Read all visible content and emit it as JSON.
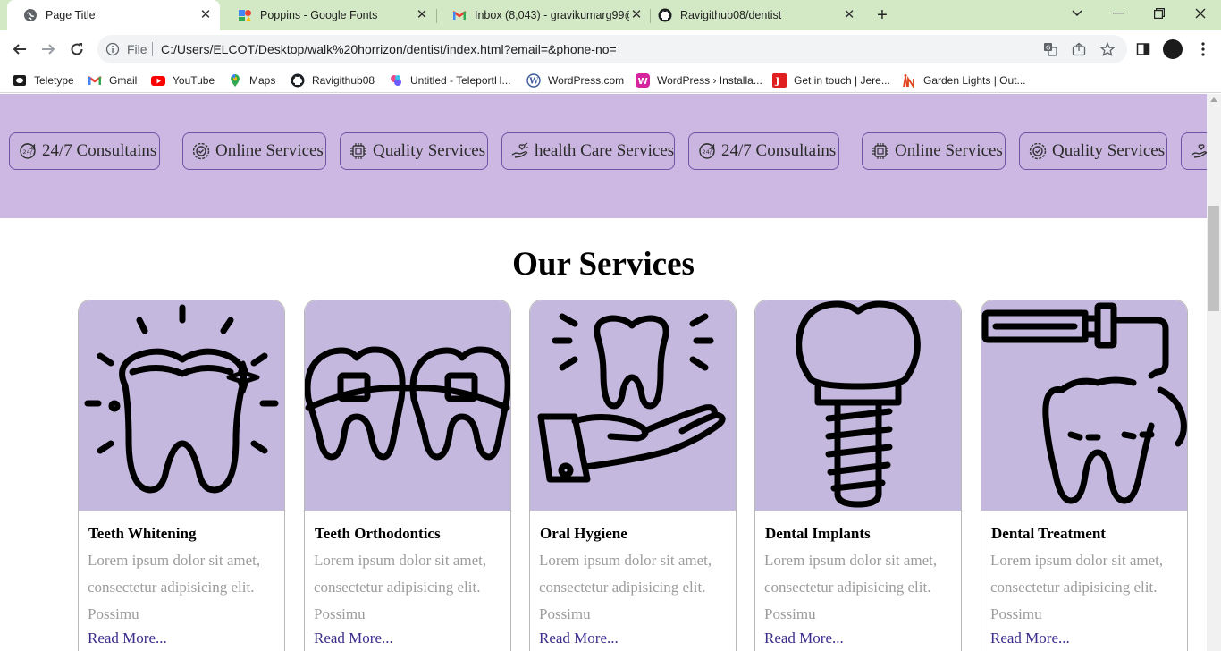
{
  "browser": {
    "tabs": [
      {
        "title": "Page Title",
        "icon": "globe-icon",
        "active": true
      },
      {
        "title": "Poppins - Google Fonts",
        "icon": "google-fonts-icon",
        "active": false
      },
      {
        "title": "Inbox (8,043) - gravikumarg99@g",
        "icon": "gmail-icon",
        "active": false
      },
      {
        "title": "Ravigithub08/dentist",
        "icon": "github-icon",
        "active": false
      }
    ],
    "new_tab": "+",
    "address": {
      "scheme_label": "File",
      "url": "C:/Users/ELCOT/Desktop/walk%20horrizon/dentist/index.html?email=&phone-no="
    },
    "bookmarks": [
      {
        "label": "Teletype",
        "icon": "teletype-icon"
      },
      {
        "label": "Gmail",
        "icon": "gmail-icon"
      },
      {
        "label": "YouTube",
        "icon": "youtube-icon"
      },
      {
        "label": "Maps",
        "icon": "maps-icon"
      },
      {
        "label": "Ravigithub08",
        "icon": "github-icon"
      },
      {
        "label": "Untitled - TeleportH...",
        "icon": "teleporthq-icon"
      },
      {
        "label": "WordPress.com",
        "icon": "wordpress-icon"
      },
      {
        "label": "WordPress › Installa...",
        "icon": "wordpress-install-icon"
      },
      {
        "label": "Get in touch | Jere...",
        "icon": "jeremy-icon"
      },
      {
        "label": "Garden Lights | Out...",
        "icon": "garden-lights-icon"
      }
    ]
  },
  "marquee": {
    "items": [
      {
        "label": "24/7 Consultains",
        "icon": "clock-24-icon"
      },
      {
        "label": "Online Services",
        "icon": "badge-check-icon"
      },
      {
        "label": "Quality Services",
        "icon": "chip-icon"
      },
      {
        "label": "health Care Services",
        "icon": "hand-heart-icon"
      },
      {
        "label": "24/7 Consultains",
        "icon": "clock-24-icon"
      },
      {
        "label": "Online Services",
        "icon": "chip-icon"
      },
      {
        "label": "Quality Services",
        "icon": "badge-check-icon"
      },
      {
        "label": "",
        "icon": "hand-heart-icon"
      }
    ]
  },
  "services": {
    "title": "Our Services",
    "cards": [
      {
        "title": "Teeth Whitening",
        "desc": "Lorem ipsum dolor sit amet, consectetur adipisicing elit. Possimu",
        "link": "Read More...",
        "icon": "sparkling-tooth-icon"
      },
      {
        "title": "Teeth Orthodontics",
        "desc": "Lorem ipsum dolor sit amet, consectetur adipisicing elit. Possimu",
        "link": "Read More...",
        "icon": "braces-icon"
      },
      {
        "title": "Oral Hygiene",
        "desc": "Lorem ipsum dolor sit amet, consectetur adipisicing elit. Possimu",
        "link": "Read More...",
        "icon": "tooth-in-hand-icon"
      },
      {
        "title": "Dental Implants",
        "desc": "Lorem ipsum dolor sit amet, consectetur adipisicing elit. Possimu",
        "link": "Read More...",
        "icon": "dental-implant-icon"
      },
      {
        "title": "Dental Treatment",
        "desc": "Lorem ipsum dolor sit amet, consectetur adipisicing elit. Possimu",
        "link": "Read More...",
        "icon": "dental-drill-icon"
      }
    ]
  },
  "colors": {
    "tab_strip": "#d3e9c6",
    "marquee_band": "#ccb8e2",
    "pill_border": "#6d55a6",
    "card_image_bg": "#c5b8de",
    "link": "#3a2d8c",
    "desc_text": "#9c9c9c"
  }
}
